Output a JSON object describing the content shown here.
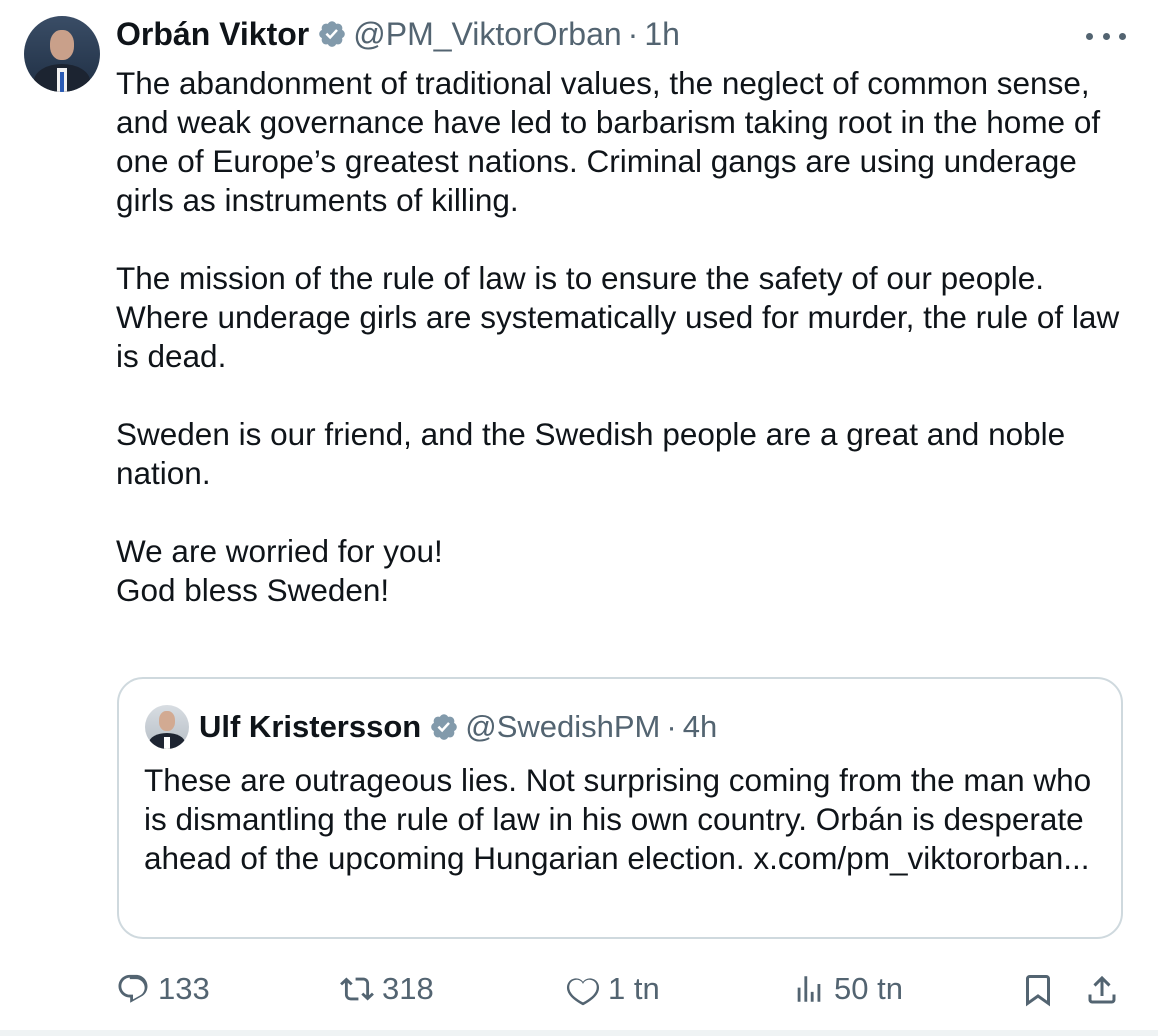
{
  "author": {
    "name": "Orbán Viktor",
    "handle": "@PM_ViktorOrban",
    "time": "1h",
    "separator": "·",
    "verified": true
  },
  "tweet": {
    "paragraphs": [
      "The abandonment of traditional values, the neglect of common sense, and weak governance have led to barbarism taking root in the home of one of Europe’s greatest nations. Criminal gangs are using underage girls as instruments of killing.",
      "The mission of the rule of law is to ensure the safety of our people. Where underage girls are systematically used for murder, the rule of law is dead.",
      "Sweden is our friend, and the Swedish people are a great and noble nation."
    ],
    "closing_line_1": "We are worried for you!",
    "closing_line_2": "God bless Sweden!"
  },
  "quote": {
    "name": "Ulf Kristersson",
    "handle": "@SwedishPM",
    "time": "4h",
    "separator": "·",
    "verified": true,
    "text": "These are outrageous lies. Not surprising coming from the man who is dismantling the rule of law in his own country. Orbán is desperate ahead of the upcoming Hungarian election. x.com/pm_viktororban..."
  },
  "actions": {
    "replies": "133",
    "reposts": "318",
    "likes": "1 tn",
    "views": "50 tn"
  },
  "colors": {
    "text": "#0f1419",
    "secondary": "#536471",
    "verified_badge": "#829aab",
    "border": "#cfd9de"
  }
}
